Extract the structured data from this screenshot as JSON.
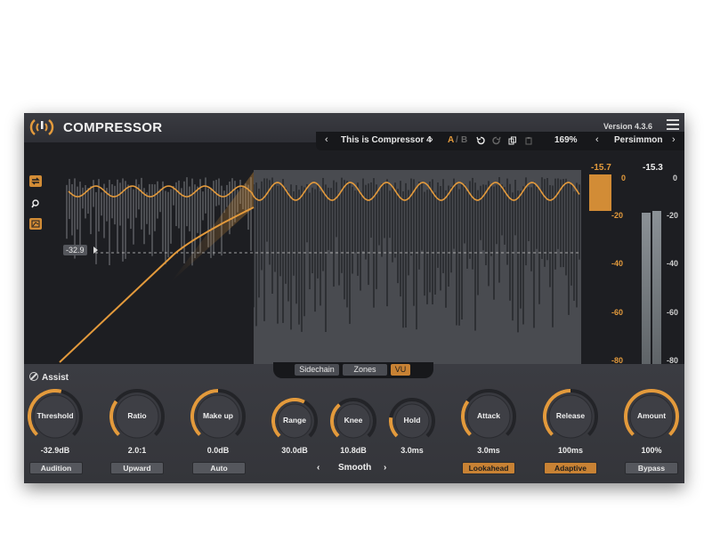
{
  "app": {
    "title": "COMPRESSOR",
    "version": "Version 4.3.6"
  },
  "preset": {
    "name": "This is Compressor 4",
    "a_label": "A",
    "sep": "/",
    "b_label": "B",
    "zoom": "169%",
    "theme": "Persimmon"
  },
  "display": {
    "threshold_label": "-32.9",
    "gain_reduction_readout": "-15.7",
    "level_readout": "-15.3",
    "gr_scale": [
      "0",
      "-20",
      "-40",
      "-60",
      "-80"
    ],
    "level_scale": [
      "0",
      "-20",
      "-40",
      "-60",
      "-80"
    ]
  },
  "tabs": [
    "Sidechain",
    "Zones",
    "VU"
  ],
  "assist_label": "Assist",
  "knobs": [
    {
      "label": "Threshold",
      "value": "-32.9dB",
      "fraction": 0.55
    },
    {
      "label": "Ratio",
      "value": "2.0:1",
      "fraction": 0.3
    },
    {
      "label": "Make up",
      "value": "0.0dB",
      "fraction": 0.5
    },
    {
      "label": "Range",
      "value": "30.0dB",
      "fraction": 0.6
    },
    {
      "label": "Knee",
      "value": "10.8dB",
      "fraction": 0.35
    },
    {
      "label": "Hold",
      "value": "3.0ms",
      "fraction": 0.2
    },
    {
      "label": "Attack",
      "value": "3.0ms",
      "fraction": 0.3
    },
    {
      "label": "Release",
      "value": "100ms",
      "fraction": 0.5
    },
    {
      "label": "Amount",
      "value": "100%",
      "fraction": 1.0
    }
  ],
  "buttons": {
    "audition": "Audition",
    "upward": "Upward",
    "auto": "Auto",
    "smooth": "Smooth",
    "lookahead": "Lookahead",
    "adaptive": "Adaptive",
    "bypass": "Bypass"
  },
  "colors": {
    "accent": "#e39a3c",
    "background": "#1c1d21",
    "panel": "#3a3b41"
  }
}
